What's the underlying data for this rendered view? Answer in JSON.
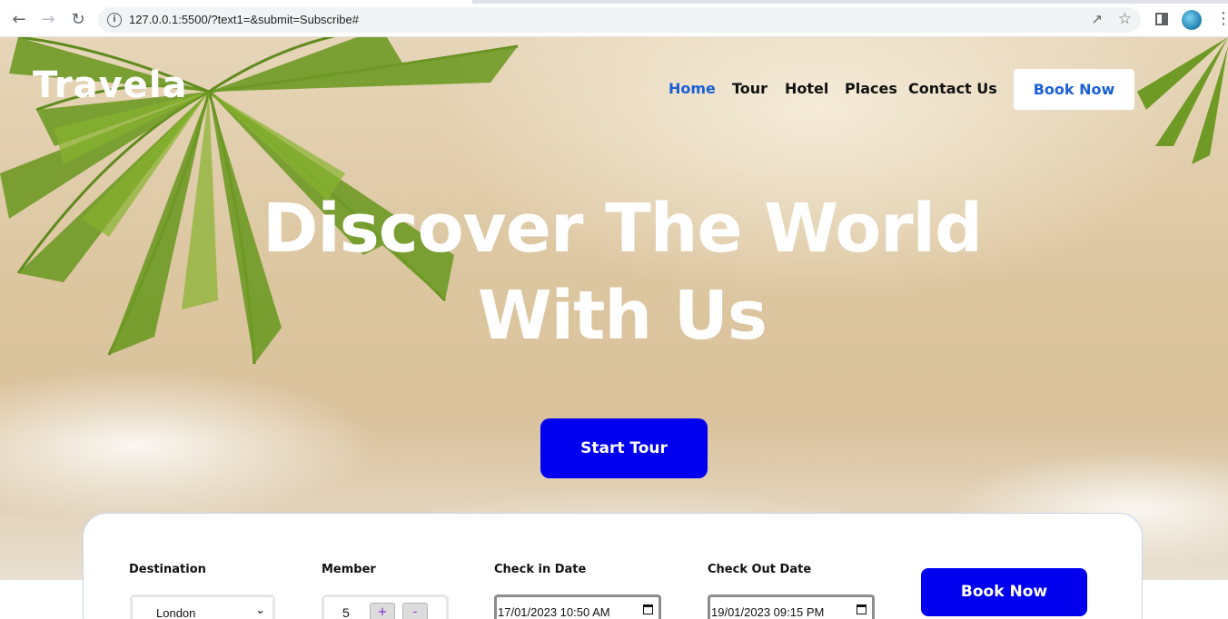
{
  "browser": {
    "url": "127.0.0.1:5500/?text1=&submit=Subscribe#",
    "back_icon": "arrow-left-icon",
    "forward_icon": "arrow-right-icon",
    "reload_icon": "reload-icon",
    "menu_icon": "kebab-icon"
  },
  "header": {
    "logo": "Travela",
    "nav": [
      "Home",
      "Tour",
      "Hotel",
      "Places",
      "Contact Us"
    ],
    "active_nav": "Home",
    "book_button": "Book Now"
  },
  "hero": {
    "title_line1": "Discover The World",
    "title_line2": "With Us",
    "cta": "Start Tour"
  },
  "booking": {
    "destination_label": "Destination",
    "destination_value": "London",
    "member_label": "Member",
    "member_value": "5",
    "plus": "+",
    "minus": "-",
    "checkin_label": "Check in Date",
    "checkin_value": "17/01/2023 10:50  AM",
    "checkout_label": "Check Out Date",
    "checkout_value": "19/01/2023 09:15  PM",
    "book_button": "Book Now"
  },
  "colors": {
    "accent_blue": "#0000ee",
    "nav_active": "#1a5fd6"
  }
}
